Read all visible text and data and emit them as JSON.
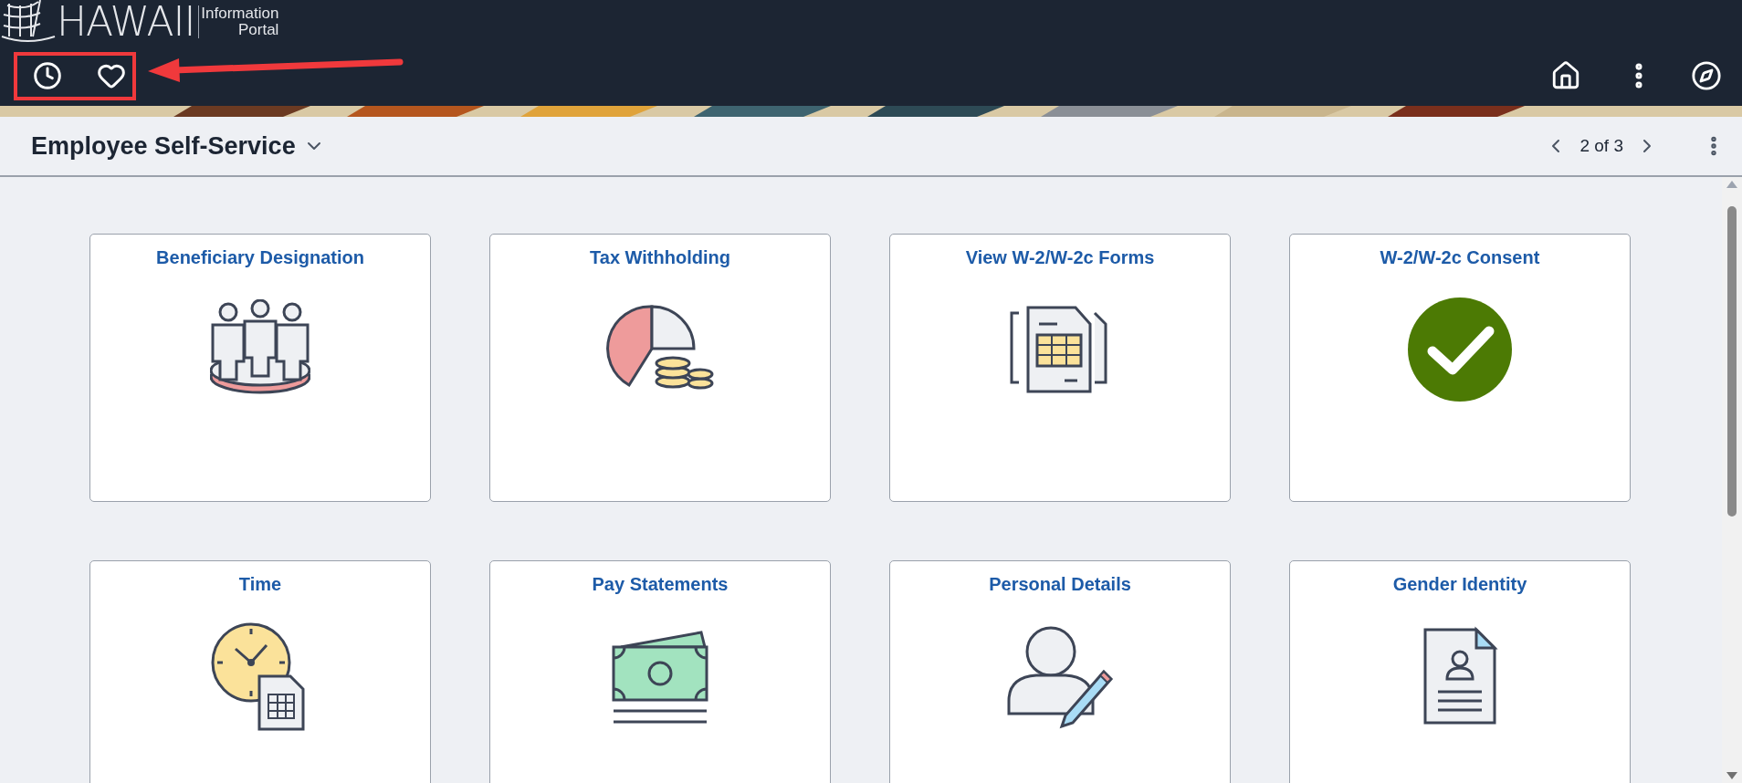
{
  "logo": {
    "name": "HAWAII",
    "line_1": "Information",
    "line_2": "Portal"
  },
  "page": {
    "title": "Employee Self-Service",
    "pager": "2 of 3"
  },
  "tiles": [
    {
      "title": "Beneficiary Designation"
    },
    {
      "title": "Tax Withholding"
    },
    {
      "title": "View W-2/W-2c Forms"
    },
    {
      "title": "W-2/W-2c Consent"
    },
    {
      "title": "Time"
    },
    {
      "title": "Pay Statements"
    },
    {
      "title": "Personal Details"
    },
    {
      "title": "Gender Identity"
    }
  ]
}
